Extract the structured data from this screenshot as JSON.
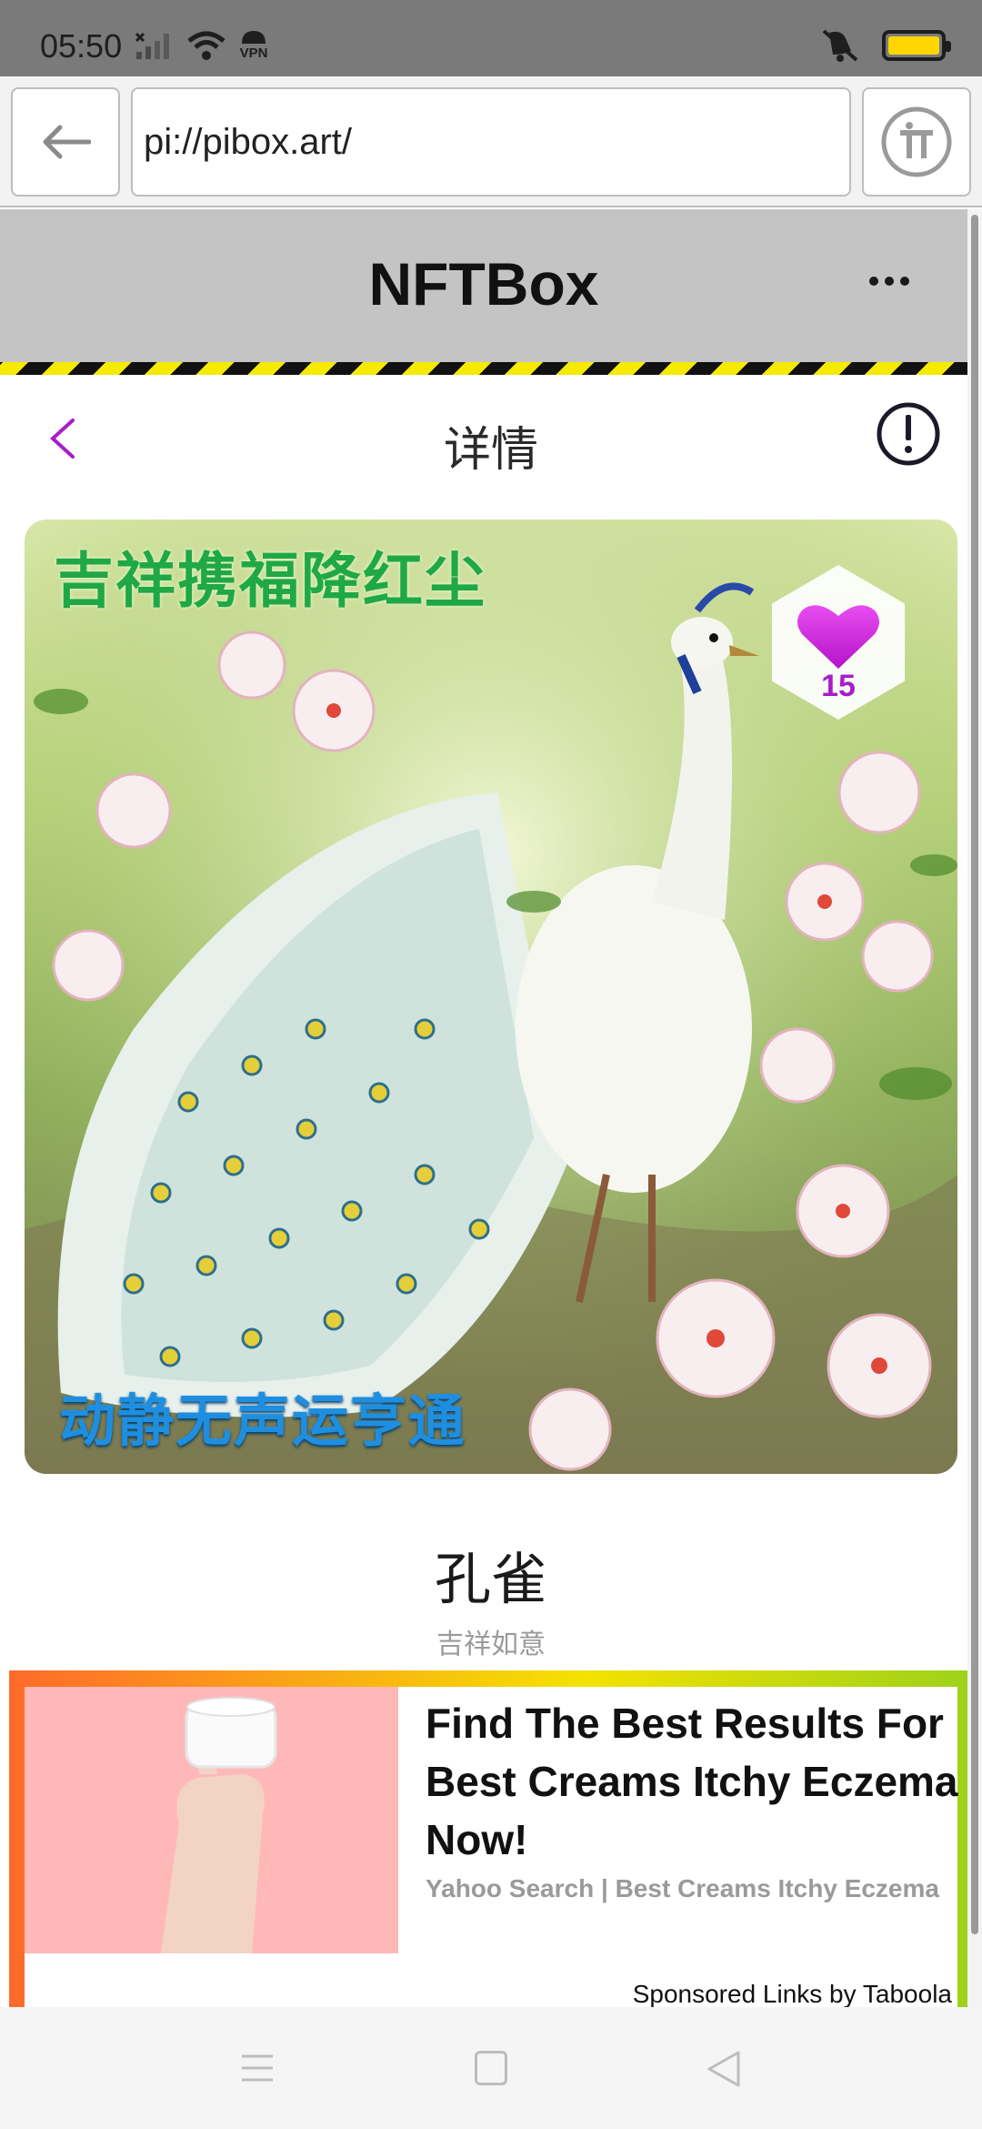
{
  "status_bar": {
    "time": "05:50",
    "icons": [
      "signal-icon",
      "wifi-icon",
      "vpn-icon",
      "vibrate-icon",
      "battery-icon"
    ],
    "vpn_label": "VPN"
  },
  "browser": {
    "url": "pi://pibox.art/",
    "back_icon": "arrow-left-icon",
    "pi_icon": "pi-logo-icon"
  },
  "app_header": {
    "title": "NFTBox",
    "more_icon": "more-horizontal-icon"
  },
  "detail": {
    "title": "详情",
    "back_icon": "chevron-left-icon",
    "report_icon": "alert-circle-icon"
  },
  "artwork": {
    "caption_top": "吉祥携福降红尘",
    "caption_bottom": "动静无声运亨通",
    "likes": "15",
    "like_icon": "heart-icon"
  },
  "nft": {
    "title": "孔雀",
    "subtitle": "吉祥如意"
  },
  "ad": {
    "headline": "Find The Best Results For Best Creams Itchy Eczema Now!",
    "source": "Yahoo Search | Best Creams Itchy Eczema",
    "sponsor": "Sponsored Links by Taboola"
  },
  "colors": {
    "accent_purple": "#a81ec8",
    "hazard_yellow": "#f5ea00",
    "caption_green": "#1fa845",
    "caption_blue": "#1e8fe0"
  }
}
